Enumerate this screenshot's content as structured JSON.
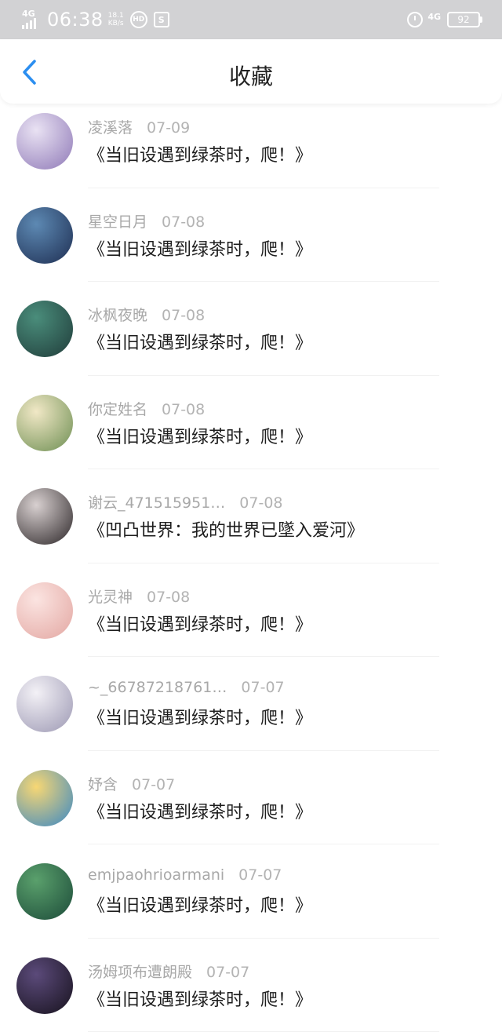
{
  "status_bar": {
    "network": "4G",
    "time": "06:38",
    "speed_value": "18.1",
    "speed_unit": "KB/s",
    "network_right": "4G",
    "battery": "92"
  },
  "header": {
    "title": "收藏",
    "back_icon": "chevron-left-icon",
    "accent_color": "#2b8ef0"
  },
  "items": [
    {
      "user": "凌溪落",
      "date": "07-09",
      "book": "《当旧设遇到绿茶时，爬！》",
      "colors": [
        "#e9e2f3",
        "#8f79b7"
      ]
    },
    {
      "user": "星空日月",
      "date": "07-08",
      "book": "《当旧设遇到绿茶时，爬！》",
      "colors": [
        "#5d89b3",
        "#1e2e52"
      ]
    },
    {
      "user": "冰枫夜晚",
      "date": "07-08",
      "book": "《当旧设遇到绿茶时，爬！》",
      "colors": [
        "#4a8d7b",
        "#203c3a"
      ]
    },
    {
      "user": "你定姓名",
      "date": "07-08",
      "book": "《当旧设遇到绿茶时，爬！》",
      "colors": [
        "#f1e8c6",
        "#6d8e52"
      ]
    },
    {
      "user": "谢云_471515951…",
      "date": "07-08",
      "book": "《凹凸世界：我的世界已墜入爱河》",
      "colors": [
        "#d8d0d0",
        "#2c2628"
      ]
    },
    {
      "user": "光灵神",
      "date": "07-08",
      "book": "《当旧设遇到绿茶时，爬！》",
      "colors": [
        "#fbe4e1",
        "#e3a7a2"
      ]
    },
    {
      "user": "~_66787218761…",
      "date": "07-07",
      "book": "《当旧设遇到绿茶时，爬！》",
      "colors": [
        "#f3f1f6",
        "#9c98b3"
      ]
    },
    {
      "user": "妤含",
      "date": "07-07",
      "book": "《当旧设遇到绿茶时，爬！》",
      "colors": [
        "#f7d774",
        "#3a88c4"
      ]
    },
    {
      "user": "emjpaohrioarmani",
      "date": "07-07",
      "book": "《当旧设遇到绿茶时，爬！》",
      "colors": [
        "#5aa06c",
        "#1c4b39"
      ]
    },
    {
      "user": "汤姆项布遭朗殿",
      "date": "07-07",
      "book": "《当旧设遇到绿茶时，爬！》",
      "colors": [
        "#5b4a7a",
        "#17121d"
      ]
    }
  ]
}
